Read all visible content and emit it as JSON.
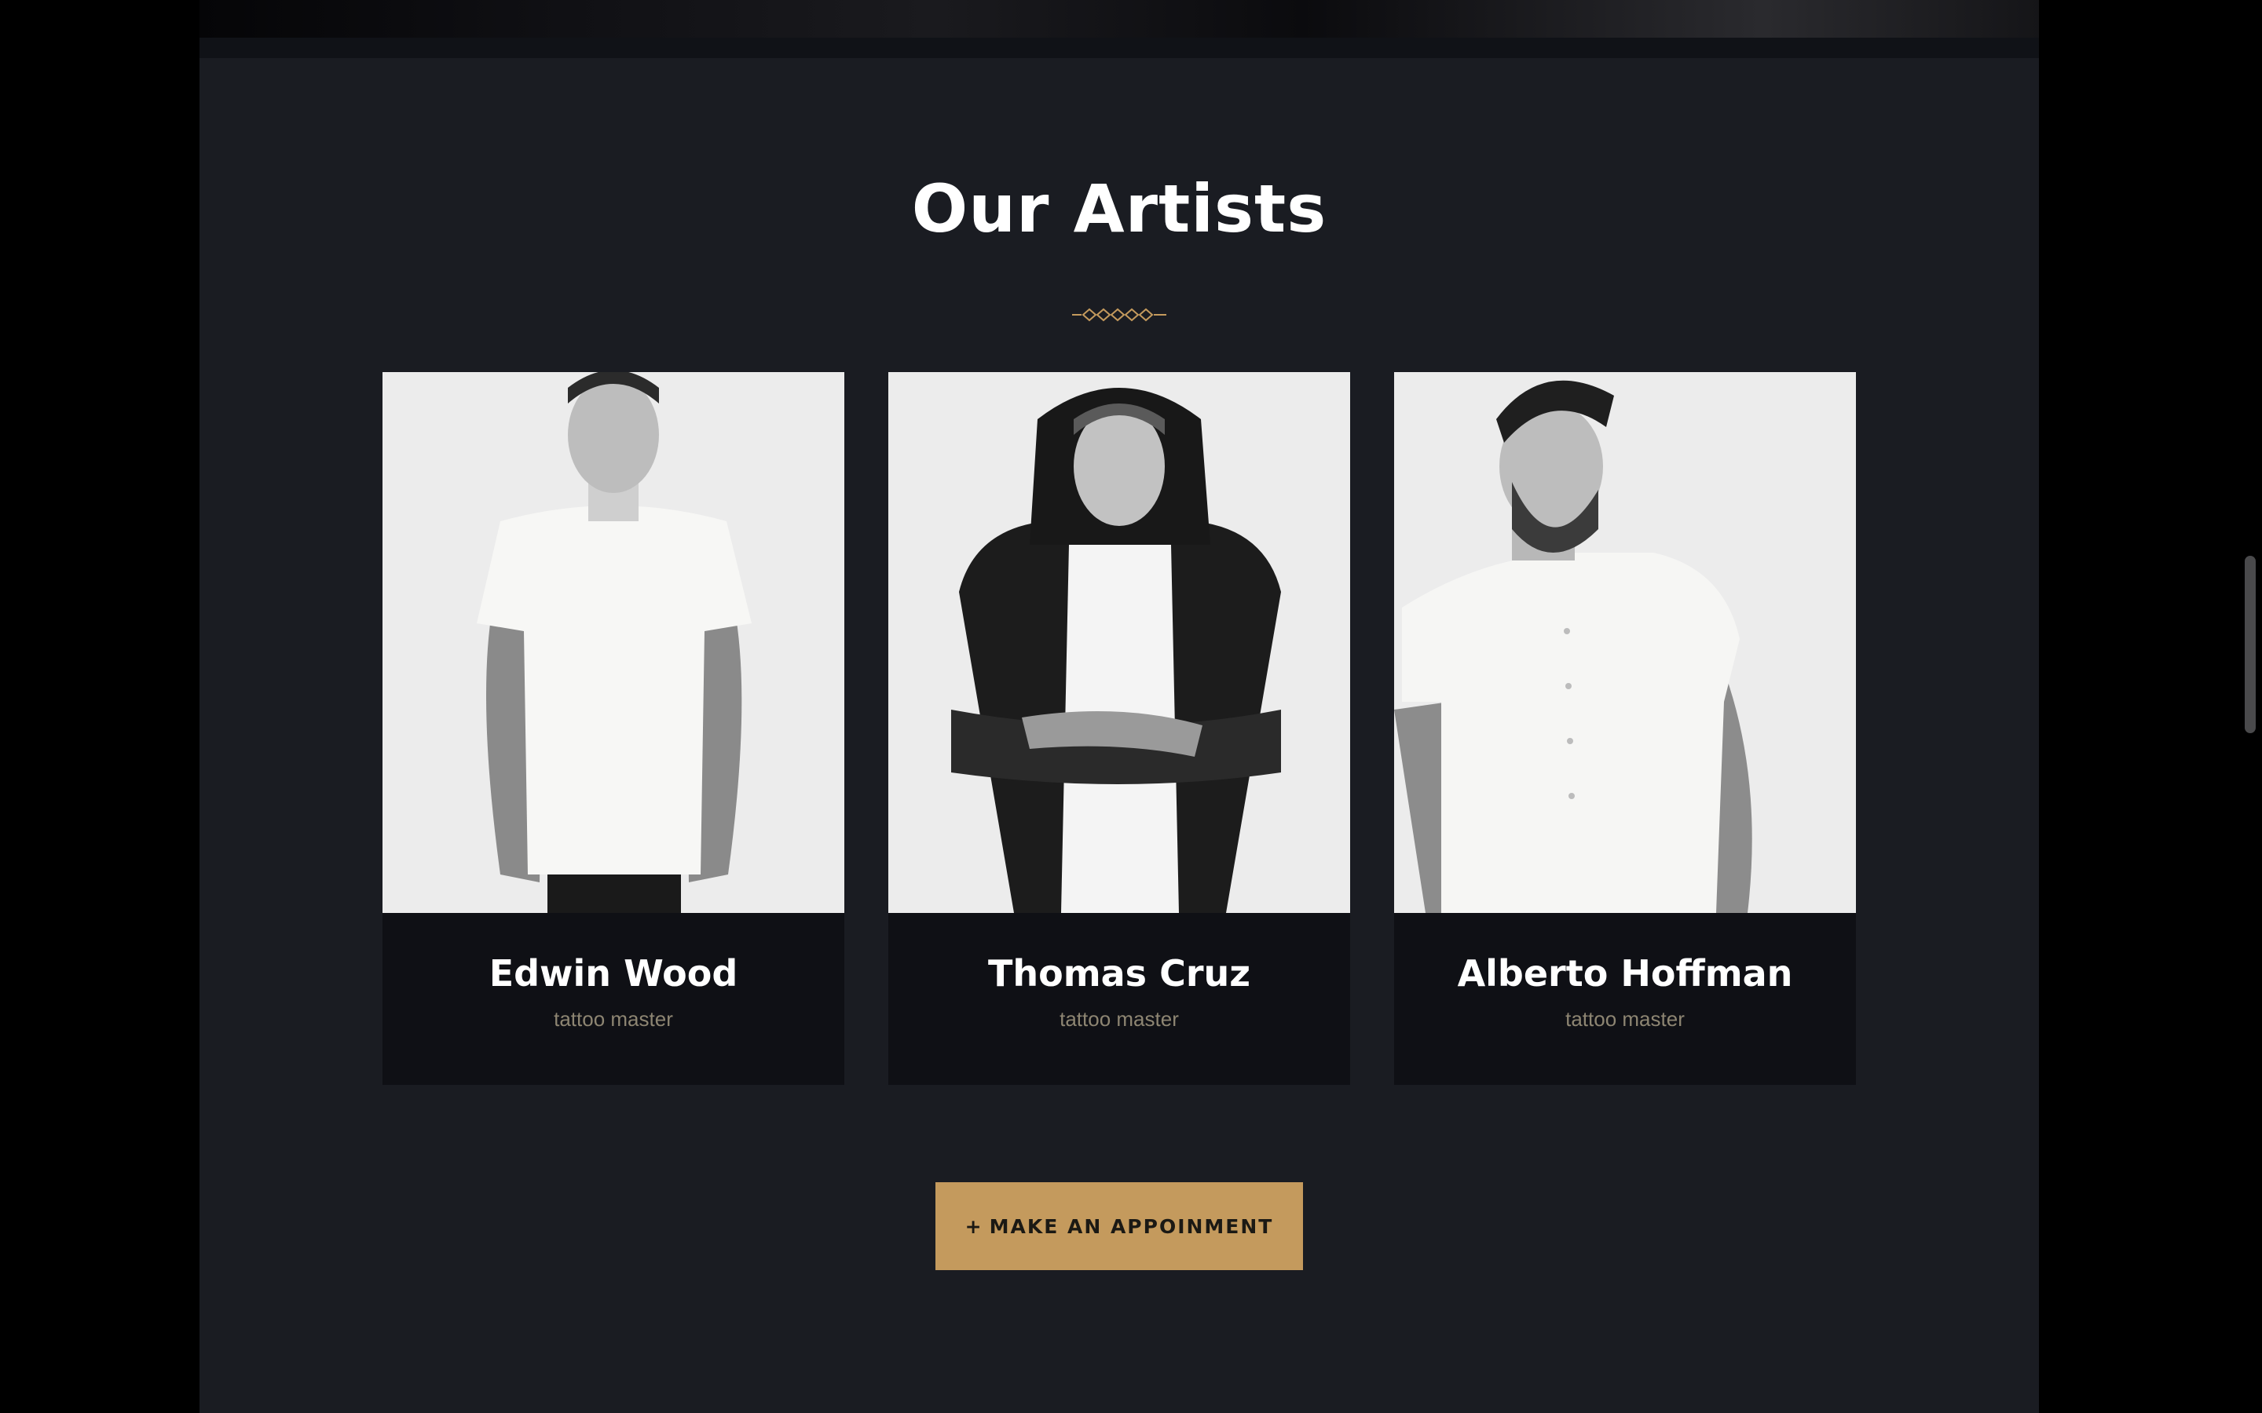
{
  "section": {
    "title": "Our Artists"
  },
  "artists": [
    {
      "name": "Edwin Wood",
      "role": "tattoo master",
      "photo": "portrait-white-tee-tattooed-arms"
    },
    {
      "name": "Thomas Cruz",
      "role": "tattoo master",
      "photo": "portrait-black-hoodie-arms-crossed"
    },
    {
      "name": "Alberto Hoffman",
      "role": "tattoo master",
      "photo": "portrait-white-shirt-bearded"
    }
  ],
  "cta": {
    "icon": "plus-icon",
    "label": "MAKE AN APPOINMENT"
  },
  "colors": {
    "background": "#000000",
    "section": "#1a1c22",
    "card": "#0f1015",
    "accent": "#c49a5d",
    "role_text": "#8d8572",
    "title_text": "#ffffff"
  }
}
